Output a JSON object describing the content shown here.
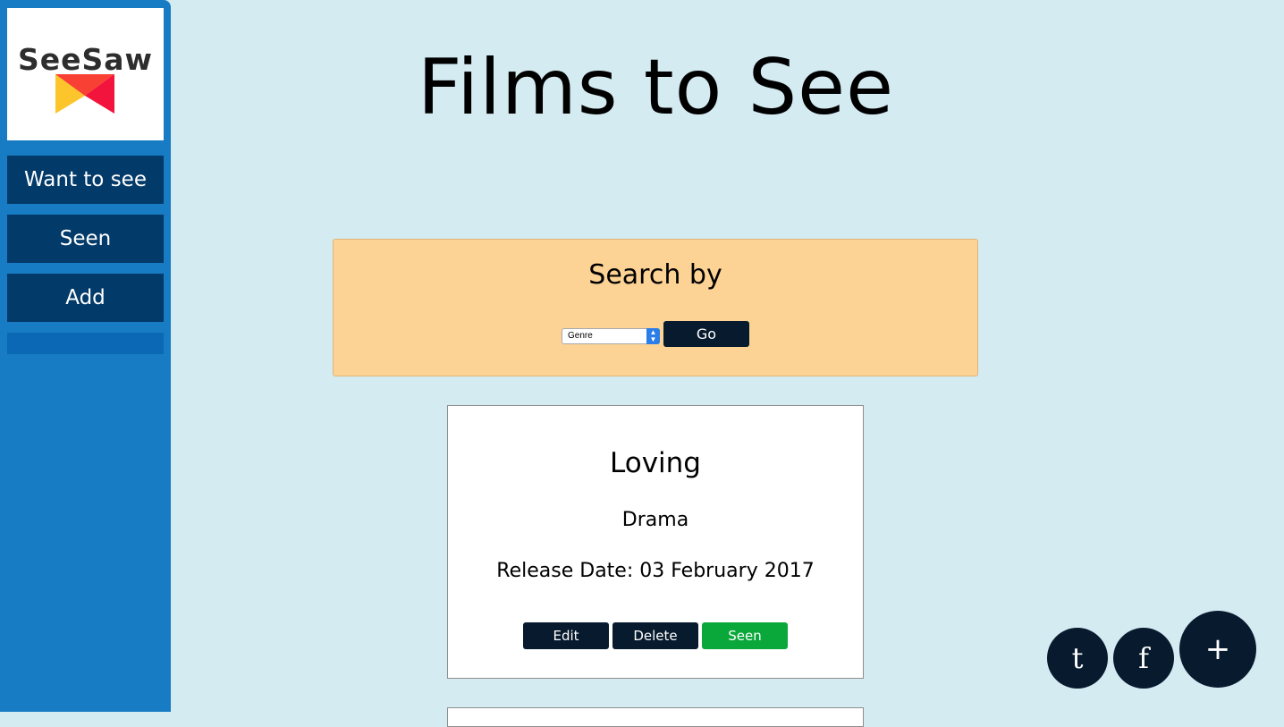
{
  "sidebar": {
    "logo_text": "SeeSaw",
    "items": [
      {
        "label": "Want to see"
      },
      {
        "label": "Seen"
      },
      {
        "label": "Add"
      }
    ]
  },
  "header": {
    "title": "Films to See"
  },
  "search": {
    "title": "Search by",
    "select_value": "Genre",
    "go_label": "Go"
  },
  "films": [
    {
      "title": "Loving",
      "genre": "Drama",
      "release": "Release Date: 03 February 2017",
      "edit_label": "Edit",
      "delete_label": "Delete",
      "seen_label": "Seen"
    }
  ],
  "fabs": {
    "tumblr": "t",
    "facebook": "f",
    "add": "+"
  },
  "colors": {
    "background": "#d4ebf2",
    "sidebar": "#177cc3",
    "nav_item": "#023a6a",
    "search_panel": "#fdd395",
    "dark_button": "#081a2e",
    "seen_button": "#0aa83a"
  }
}
